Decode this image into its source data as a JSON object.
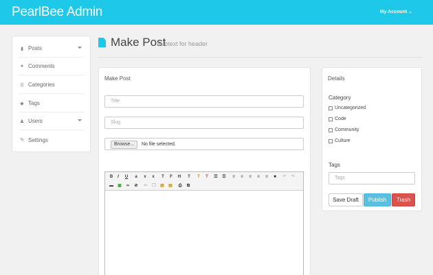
{
  "app": {
    "brand": "PearlBee Admin",
    "account_menu": "My Account"
  },
  "sidebar": {
    "items": [
      {
        "label": "Posts",
        "icon": "document-icon",
        "has_caret": true
      },
      {
        "label": "Comments",
        "icon": "comment-icon",
        "has_caret": false
      },
      {
        "label": "Categories",
        "icon": "list-icon",
        "has_caret": false
      },
      {
        "label": "Tags",
        "icon": "tag-icon",
        "has_caret": false
      },
      {
        "label": "Users",
        "icon": "user-icon",
        "has_caret": true
      },
      {
        "label": "Settings",
        "icon": "wrench-icon",
        "has_caret": false
      }
    ]
  },
  "header": {
    "title": "Make Post",
    "subtitle": "Subtext for header"
  },
  "make_post": {
    "panel_title": "Make Post",
    "title_placeholder": "Title",
    "slug_placeholder": "Slug",
    "file_button": "Browse...",
    "file_status": "No file selected."
  },
  "details": {
    "panel_title": "Details",
    "category_label": "Category",
    "categories": [
      "Uncategorized",
      "Code",
      "Community",
      "Culture"
    ],
    "tags_label": "Tags",
    "tags_placeholder": "Tags",
    "buttons": {
      "save_draft": "Save Draft",
      "publish": "Publish",
      "trash": "Trash"
    }
  },
  "colors": {
    "accent": "#1ec8e8",
    "publish": "#5bc0de",
    "trash": "#d9534f"
  }
}
